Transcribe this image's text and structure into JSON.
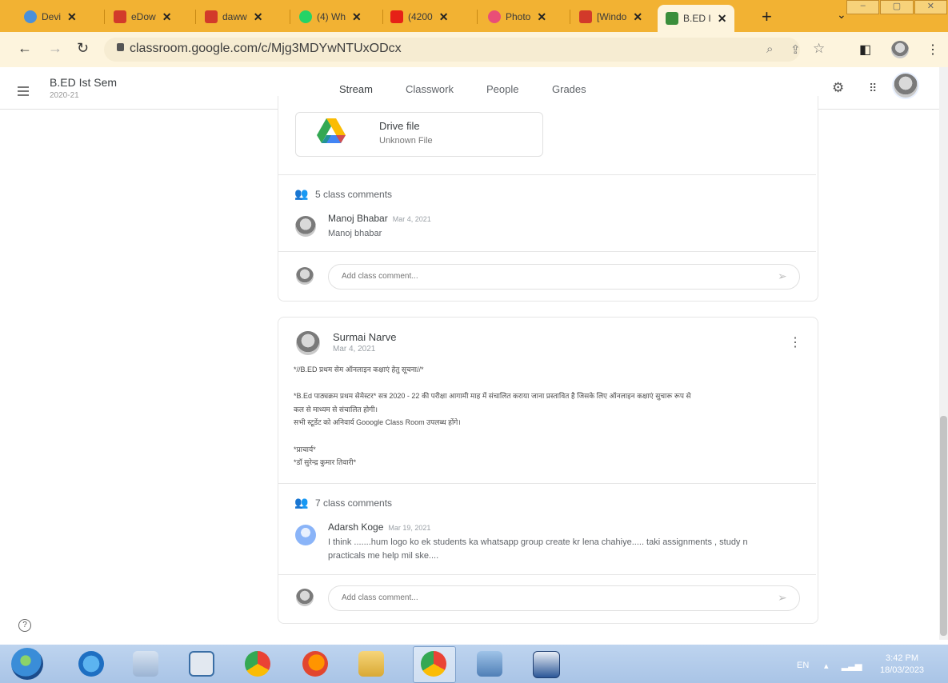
{
  "browser": {
    "tabs": [
      {
        "label": "Devi",
        "color": "#4a90d9"
      },
      {
        "label": "eDow",
        "color": "#d23a2a"
      },
      {
        "label": "daww",
        "color": "#d23a2a"
      },
      {
        "label": "(4) Wh",
        "color": "#25d366"
      },
      {
        "label": "(4200",
        "color": "#e62117"
      },
      {
        "label": "Photo",
        "color": "#e94e77"
      },
      {
        "label": "[Windo",
        "color": "#d23a2a"
      },
      {
        "label": "B.ED I",
        "color": "#3b8e3b"
      }
    ],
    "close_glyph": "✕",
    "new_tab_glyph": "+",
    "url": "classroom.google.com/c/Mjg3MDYwNTUxODcx"
  },
  "classroom": {
    "class_name": "B.ED Ist Sem",
    "class_year": "2020-21",
    "tabs": [
      "Stream",
      "Classwork",
      "People",
      "Grades"
    ]
  },
  "post1": {
    "attachment_title": "Drive file",
    "attachment_subtitle": "Unknown File",
    "comments_count": "5 class comments",
    "comment": {
      "author": "Manoj Bhabar",
      "date": "Mar 4, 2021",
      "text": "Manoj bhabar"
    },
    "input_placeholder": "Add class comment..."
  },
  "post2": {
    "author": "Surmai Narve",
    "date": "Mar 4, 2021",
    "body": [
      "*//B.ED प्रथम सेम ऑनलाइन कक्षाएं हेतु सूचना//*",
      "*B.Ed पाठ्यक्रम प्रथम सेमेस्टर* सत्र 2020 - 22 की परीक्षा आगामी माह में संचालित कराया जाना प्रस्तावित है जिसके लिए ऑनलाइन कक्षाएं सुचारू रूप से",
      "कल से माध्यम से संचालित होगी।",
      "सभी स्टूडेंट को अनिवार्य Gooogle Class Room उपलब्ध होंगे।",
      "*प्राचार्य*",
      "*डॉ सुरेन्द्र कुमार तिवारी*"
    ],
    "comments_count": "7 class comments",
    "comment": {
      "author": "Adarsh Koge",
      "date": "Mar 19, 2021",
      "text_line1": "I think .......hum logo ko ek students ka whatsapp group create kr lena chahiye..... taki assignments , study n",
      "text_line2": "practicals me help mil ske...."
    },
    "input_placeholder": "Add class comment..."
  },
  "taskbar": {
    "language": "EN",
    "time": "3:42 PM",
    "date": "18/03/2023"
  },
  "help_glyph": "?"
}
